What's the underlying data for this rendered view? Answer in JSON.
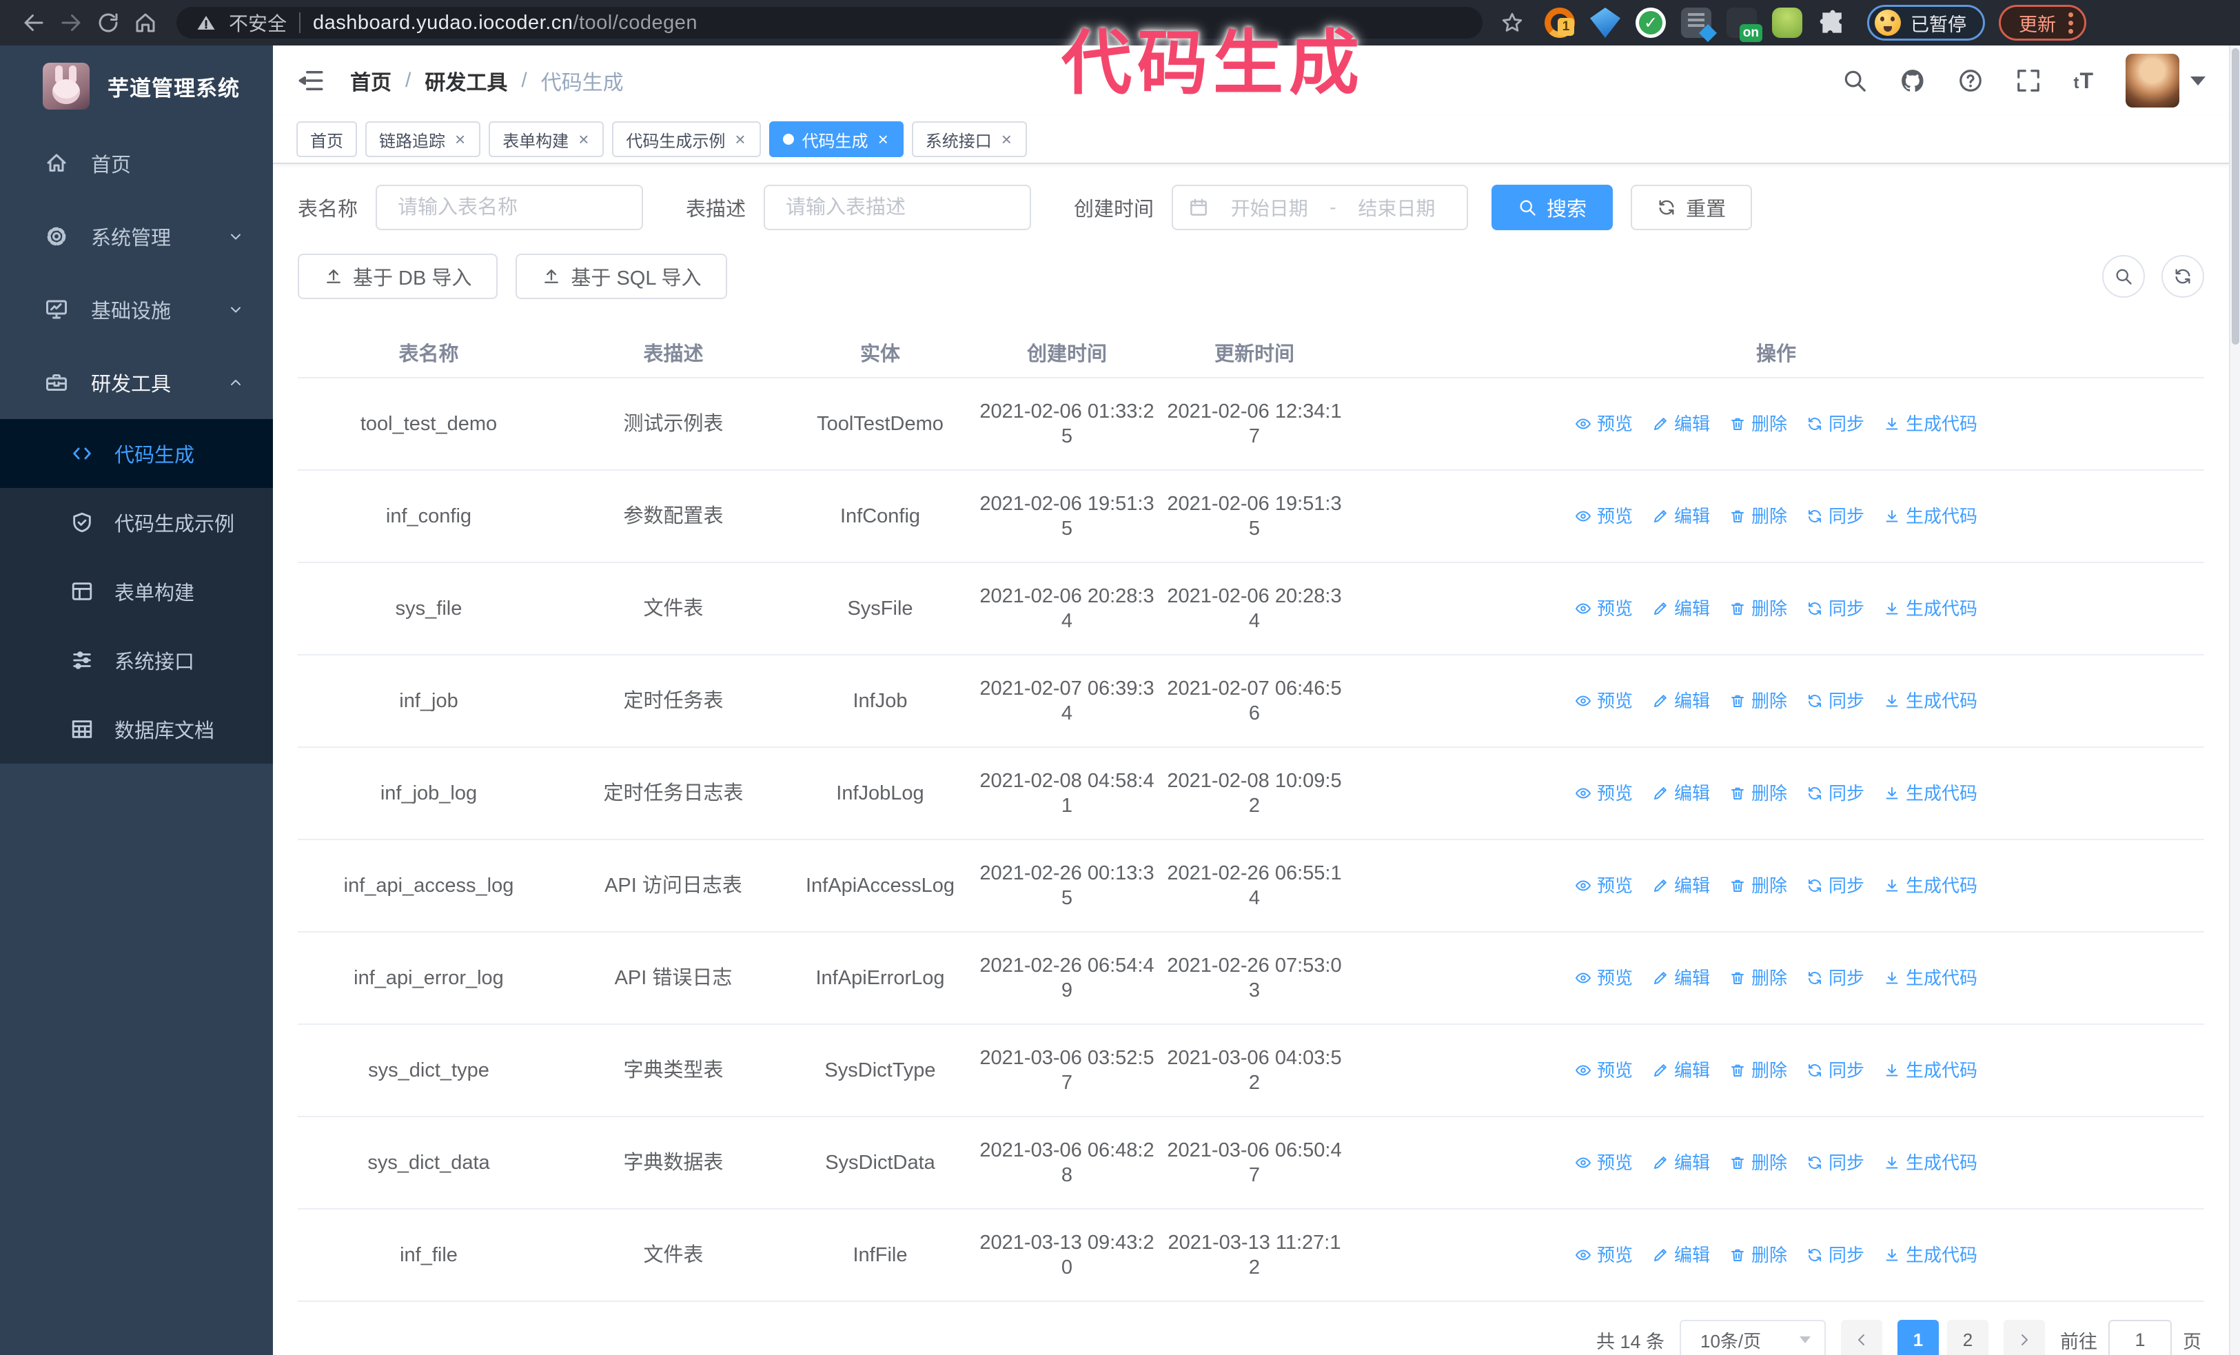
{
  "browser": {
    "security_label": "不安全",
    "url_host": "dashboard.yudao.iocoder.cn",
    "url_path": "/tool/codegen",
    "extension_badge_count": "1",
    "extension_badge_on": "on",
    "profile_badge": "已暂停",
    "update_button": "更新"
  },
  "annotation": {
    "text": "代码生成",
    "color": "#f4466c"
  },
  "sidebar": {
    "title": "芋道管理系统",
    "items": [
      {
        "label": "首页"
      },
      {
        "label": "系统管理"
      },
      {
        "label": "基础设施"
      },
      {
        "label": "研发工具",
        "expanded": true
      }
    ],
    "subitems": [
      {
        "label": "代码生成",
        "active": true
      },
      {
        "label": "代码生成示例"
      },
      {
        "label": "表单构建"
      },
      {
        "label": "系统接口"
      },
      {
        "label": "数据库文档"
      }
    ]
  },
  "breadcrumb": {
    "items": [
      "首页",
      "研发工具",
      "代码生成"
    ],
    "separator": "/"
  },
  "tabs": [
    {
      "label": "首页",
      "closable": false,
      "active": false
    },
    {
      "label": "链路追踪",
      "closable": true,
      "active": false
    },
    {
      "label": "表单构建",
      "closable": true,
      "active": false
    },
    {
      "label": "代码生成示例",
      "closable": true,
      "active": false
    },
    {
      "label": "代码生成",
      "closable": true,
      "active": true
    },
    {
      "label": "系统接口",
      "closable": true,
      "active": false
    }
  ],
  "filters": {
    "table_name_label": "表名称",
    "table_name_placeholder": "请输入表名称",
    "table_desc_label": "表描述",
    "table_desc_placeholder": "请输入表描述",
    "create_time_label": "创建时间",
    "date_start_placeholder": "开始日期",
    "date_separator": "-",
    "date_end_placeholder": "结束日期",
    "search_button": "搜索",
    "reset_button": "重置"
  },
  "toolbar": {
    "import_db_button": "基于 DB 导入",
    "import_sql_button": "基于 SQL 导入"
  },
  "table": {
    "columns": [
      "表名称",
      "表描述",
      "实体",
      "创建时间",
      "更新时间",
      "操作"
    ],
    "actions": [
      {
        "label": "预览",
        "icon": "eye-icon"
      },
      {
        "label": "编辑",
        "icon": "edit-icon"
      },
      {
        "label": "删除",
        "icon": "delete-icon"
      },
      {
        "label": "同步",
        "icon": "sync-icon"
      },
      {
        "label": "生成代码",
        "icon": "download-icon"
      }
    ],
    "rows": [
      {
        "name": "tool_test_demo",
        "desc": "测试示例表",
        "entity": "ToolTestDemo",
        "created": "2021-02-06 01:33:25",
        "updated": "2021-02-06 12:34:17"
      },
      {
        "name": "inf_config",
        "desc": "参数配置表",
        "entity": "InfConfig",
        "created": "2021-02-06 19:51:35",
        "updated": "2021-02-06 19:51:35"
      },
      {
        "name": "sys_file",
        "desc": "文件表",
        "entity": "SysFile",
        "created": "2021-02-06 20:28:34",
        "updated": "2021-02-06 20:28:34"
      },
      {
        "name": "inf_job",
        "desc": "定时任务表",
        "entity": "InfJob",
        "created": "2021-02-07 06:39:34",
        "updated": "2021-02-07 06:46:56"
      },
      {
        "name": "inf_job_log",
        "desc": "定时任务日志表",
        "entity": "InfJobLog",
        "created": "2021-02-08 04:58:41",
        "updated": "2021-02-08 10:09:52"
      },
      {
        "name": "inf_api_access_log",
        "desc": "API 访问日志表",
        "entity": "InfApiAccessLog",
        "created": "2021-02-26 00:13:35",
        "updated": "2021-02-26 06:55:14"
      },
      {
        "name": "inf_api_error_log",
        "desc": "API 错误日志",
        "entity": "InfApiErrorLog",
        "created": "2021-02-26 06:54:49",
        "updated": "2021-02-26 07:53:03"
      },
      {
        "name": "sys_dict_type",
        "desc": "字典类型表",
        "entity": "SysDictType",
        "created": "2021-03-06 03:52:57",
        "updated": "2021-03-06 04:03:52"
      },
      {
        "name": "sys_dict_data",
        "desc": "字典数据表",
        "entity": "SysDictData",
        "created": "2021-03-06 06:48:28",
        "updated": "2021-03-06 06:50:47"
      },
      {
        "name": "inf_file",
        "desc": "文件表",
        "entity": "InfFile",
        "created": "2021-03-13 09:43:20",
        "updated": "2021-03-13 11:27:12"
      }
    ]
  },
  "pagination": {
    "total": "共 14 条",
    "page_size": "10条/页",
    "pages": [
      "1",
      "2"
    ],
    "active_page": "1",
    "goto_label": "前往",
    "goto_value": "1",
    "goto_suffix": "页"
  },
  "colors": {
    "primary": "#409eff",
    "sidebar_bg": "#304156",
    "submenu_bg": "#1f2d3d",
    "active_submenu_bg": "#001528",
    "annotation_pink": "#f4466c",
    "toolbar_dark": "#262a33"
  }
}
